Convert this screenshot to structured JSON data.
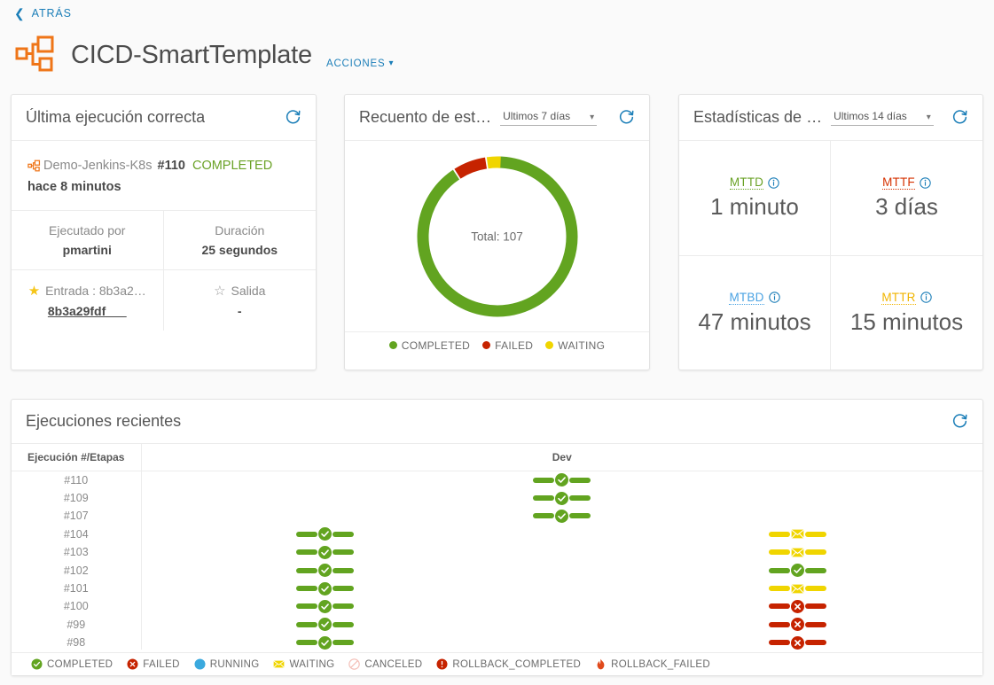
{
  "back": {
    "label": "ATRÁS",
    "icon": "chevron-left-icon"
  },
  "header": {
    "title": "CICD-SmartTemplate",
    "actions_label": "ACCIONES",
    "icon": "pipeline-template-icon"
  },
  "last_run_card": {
    "title": "Última ejecución correcta",
    "refresh_icon": "refresh-icon",
    "pipeline_name": "Demo-Jenkins-K8s",
    "run_number": "#110",
    "status": "COMPLETED",
    "status_color": "#6aa226",
    "ago": "hace 8 minutos",
    "executed_by_label": "Ejecutado por",
    "executed_by_value": "pmartini",
    "duration_label": "Duración",
    "duration_value": "25 segundos",
    "input_label": "Entrada : 8b3a2…",
    "input_value": "8b3a29fdf___",
    "output_label": "Salida",
    "output_value": "-"
  },
  "status_count_card": {
    "title": "Recuento de est…",
    "range_value": "Ultimos 7 días",
    "refresh_icon": "refresh-icon",
    "total_label": "Total: 107"
  },
  "chart_data": {
    "type": "pie",
    "title": "Recuento de est…",
    "total": 107,
    "categories": [
      "COMPLETED",
      "FAILED",
      "WAITING"
    ],
    "values": [
      97,
      7,
      3
    ],
    "colors": [
      "#62a420",
      "#c62300",
      "#f0d500"
    ],
    "legend_position": "bottom",
    "donut": true
  },
  "stats_card": {
    "title": "Estadísticas de …",
    "range_value": "Ultimos 14 días",
    "refresh_icon": "refresh-icon",
    "items": [
      {
        "key": "MTTD",
        "value": "1 minuto",
        "color": "#6aa226"
      },
      {
        "key": "MTTF",
        "value": "3 días",
        "color": "#d63100"
      },
      {
        "key": "MTBD",
        "value": "47 minutos",
        "color": "#4ba3e3"
      },
      {
        "key": "MTTR",
        "value": "15 minutos",
        "color": "#f0b400"
      }
    ],
    "info_icon": "info-icon"
  },
  "recent_runs_card": {
    "title": "Ejecuciones recientes",
    "refresh_icon": "refresh-icon",
    "columns": [
      "Ejecución #/Etapas",
      "Dev"
    ],
    "rows": [
      {
        "run": "#110",
        "stages": [
          {
            "status": "COMPLETED",
            "offset": 0
          }
        ]
      },
      {
        "run": "#109",
        "stages": [
          {
            "status": "COMPLETED",
            "offset": 0
          }
        ]
      },
      {
        "run": "#107",
        "stages": [
          {
            "status": "COMPLETED",
            "offset": 0
          }
        ]
      },
      {
        "run": "#104",
        "stages": [
          {
            "status": "COMPLETED",
            "offset": -235
          },
          {
            "status": "WAITING",
            "offset": 233
          }
        ]
      },
      {
        "run": "#103",
        "stages": [
          {
            "status": "COMPLETED",
            "offset": -235
          },
          {
            "status": "WAITING",
            "offset": 233
          }
        ]
      },
      {
        "run": "#102",
        "stages": [
          {
            "status": "COMPLETED",
            "offset": -235
          },
          {
            "status": "COMPLETED",
            "offset": 233
          }
        ]
      },
      {
        "run": "#101",
        "stages": [
          {
            "status": "COMPLETED",
            "offset": -235
          },
          {
            "status": "WAITING",
            "offset": 233
          }
        ]
      },
      {
        "run": "#100",
        "stages": [
          {
            "status": "COMPLETED",
            "offset": -235
          },
          {
            "status": "FAILED",
            "offset": 233
          }
        ]
      },
      {
        "run": "#99",
        "stages": [
          {
            "status": "COMPLETED",
            "offset": -235
          },
          {
            "status": "FAILED",
            "offset": 233
          }
        ]
      },
      {
        "run": "#98",
        "stages": [
          {
            "status": "COMPLETED",
            "offset": -235
          },
          {
            "status": "FAILED",
            "offset": 233
          }
        ]
      }
    ],
    "legend": [
      {
        "label": "COMPLETED",
        "icon": "check-circle-icon",
        "color": "#62a420"
      },
      {
        "label": "FAILED",
        "icon": "x-circle-icon",
        "color": "#c62300"
      },
      {
        "label": "RUNNING",
        "icon": "filled-circle-icon",
        "color": "#3aa9de"
      },
      {
        "label": "WAITING",
        "icon": "envelope-icon",
        "color": "#f0d500"
      },
      {
        "label": "CANCELED",
        "icon": "no-entry-icon",
        "color": "#f3bdb5"
      },
      {
        "label": "ROLLBACK_COMPLETED",
        "icon": "exclamation-circle-icon",
        "color": "#c62300"
      },
      {
        "label": "ROLLBACK_FAILED",
        "icon": "flame-icon",
        "color": "#e04a1c"
      }
    ]
  },
  "colors": {
    "accent_blue": "#1b7eb8",
    "brand_orange": "#ef7518",
    "green": "#62a420",
    "red": "#c62300",
    "yellow": "#f0d500"
  }
}
